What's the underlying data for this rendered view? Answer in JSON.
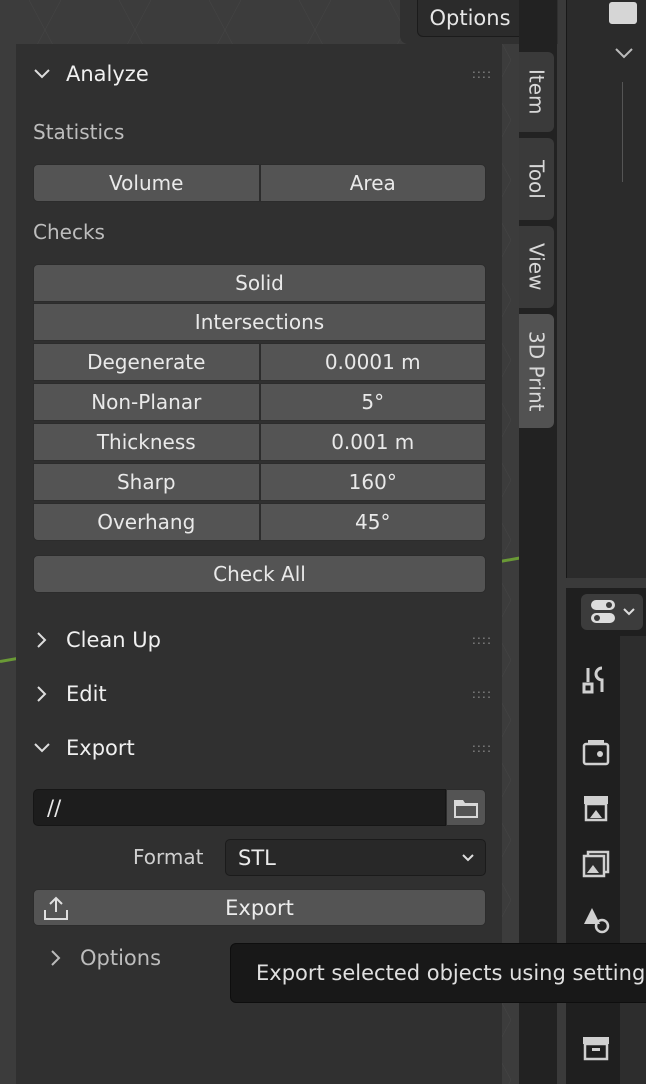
{
  "header": {
    "options_label": "Options"
  },
  "analyze": {
    "title": "Analyze",
    "statistics_label": "Statistics",
    "volume_label": "Volume",
    "area_label": "Area",
    "checks_label": "Checks",
    "solid_label": "Solid",
    "intersections_label": "Intersections",
    "rows": [
      {
        "label": "Degenerate",
        "value": "0.0001 m"
      },
      {
        "label": "Non-Planar",
        "value": "5°"
      },
      {
        "label": "Thickness",
        "value": "0.001 m"
      },
      {
        "label": "Sharp",
        "value": "160°"
      },
      {
        "label": "Overhang",
        "value": "45°"
      }
    ],
    "check_all_label": "Check All"
  },
  "clean_up": {
    "title": "Clean Up"
  },
  "edit": {
    "title": "Edit"
  },
  "export": {
    "title": "Export",
    "path_value": "//",
    "format_label": "Format",
    "format_value": "STL",
    "export_button_label": "Export",
    "options_label": "Options"
  },
  "tabs": [
    "Item",
    "Tool",
    "View",
    "3D Print"
  ],
  "tooltip": {
    "text": "Export selected objects using settings below"
  },
  "colors": {
    "accent_green": "#6a9a36",
    "panel_bg": "#303030",
    "button_bg": "#545454"
  }
}
